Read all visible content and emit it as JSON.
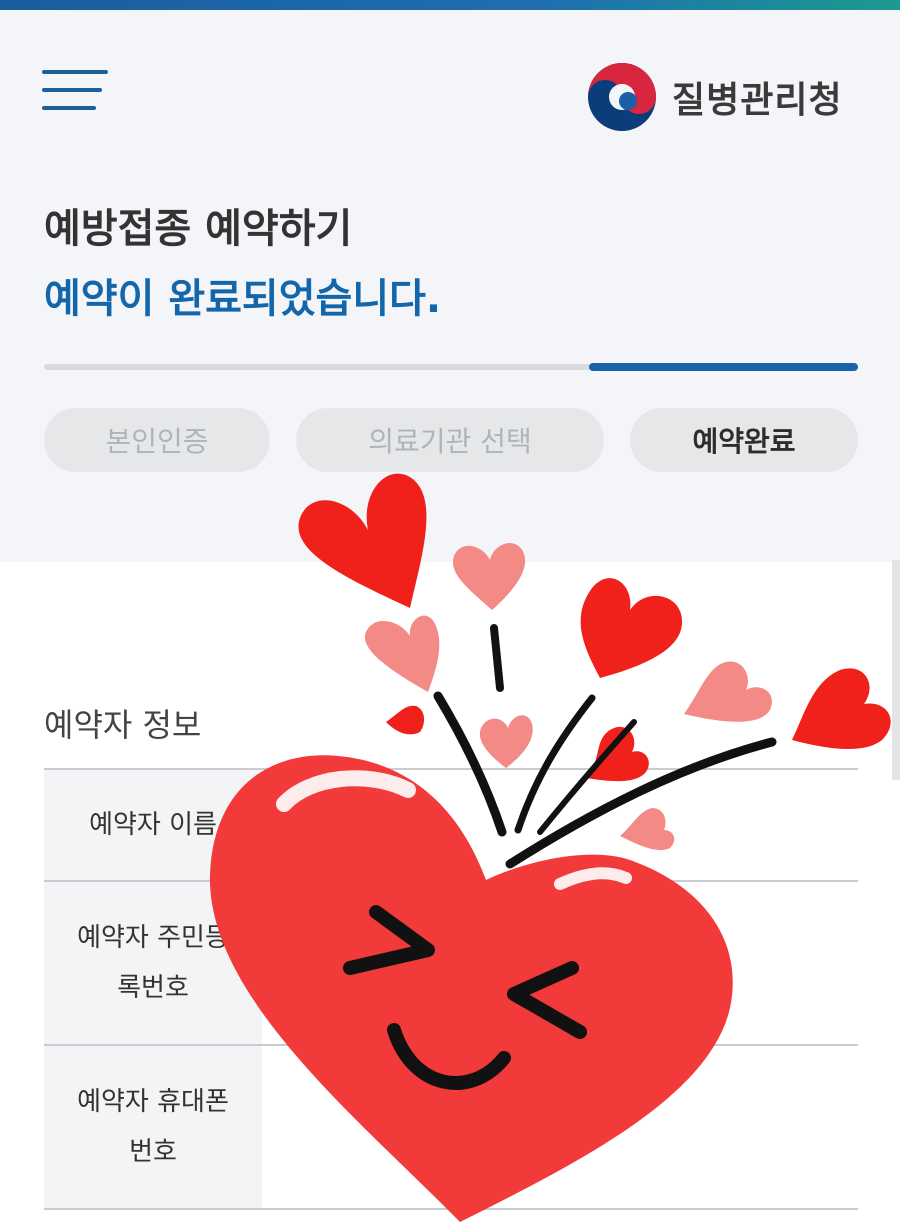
{
  "header": {
    "menu_icon": "hamburger-menu-icon",
    "logo_icon": "taegeuk-emblem-icon",
    "logo_text": "질병관리청"
  },
  "page": {
    "title": "예방접종 예약하기",
    "subtitle": "예약이 완료되었습니다."
  },
  "progress": {
    "value": 0.33,
    "total_steps": 3,
    "current_step": 3
  },
  "steps": [
    {
      "label": "본인인증",
      "state": "inactive"
    },
    {
      "label": "의료기관 선택",
      "state": "inactive"
    },
    {
      "label": "예약완료",
      "state": "active"
    }
  ],
  "reservation_info": {
    "section_title": "예약자 정보",
    "rows": [
      {
        "label": "예약자 이름"
      },
      {
        "label": "예약자 주민등\n록번호"
      },
      {
        "label": "예약자 휴대폰\n번호"
      }
    ]
  },
  "overlay": {
    "sticker_icon": "smiling-heart-sticker-icon"
  },
  "colors": {
    "accent_blue": "#1466aa",
    "progress_blue": "#1a63a8",
    "heart_red": "#f23d3b",
    "heart_pink": "#f58383"
  }
}
